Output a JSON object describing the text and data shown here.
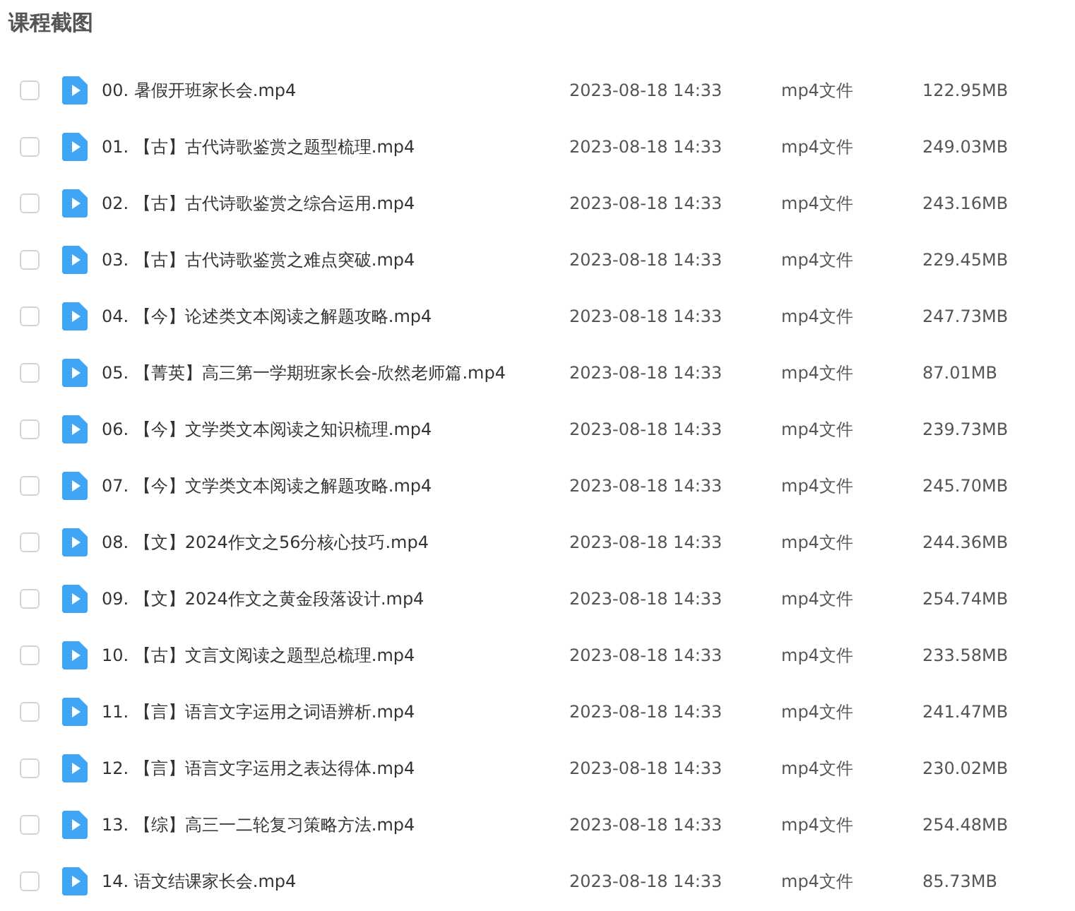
{
  "title": "课程截图",
  "files": [
    {
      "name": "00. 暑假开班家长会.mp4",
      "date": "2023-08-18 14:33",
      "type": "mp4文件",
      "size": "122.95MB",
      "checked": false
    },
    {
      "name": "01. 【古】古代诗歌鉴赏之题型梳理.mp4",
      "date": "2023-08-18 14:33",
      "type": "mp4文件",
      "size": "249.03MB",
      "checked": false
    },
    {
      "name": "02. 【古】古代诗歌鉴赏之综合运用.mp4",
      "date": "2023-08-18 14:33",
      "type": "mp4文件",
      "size": "243.16MB",
      "checked": false
    },
    {
      "name": "03. 【古】古代诗歌鉴赏之难点突破.mp4",
      "date": "2023-08-18 14:33",
      "type": "mp4文件",
      "size": "229.45MB",
      "checked": false
    },
    {
      "name": "04. 【今】论述类文本阅读之解题攻略.mp4",
      "date": "2023-08-18 14:33",
      "type": "mp4文件",
      "size": "247.73MB",
      "checked": false
    },
    {
      "name": "05. 【菁英】高三第一学期班家长会-欣然老师篇.mp4",
      "date": "2023-08-18 14:33",
      "type": "mp4文件",
      "size": "87.01MB",
      "checked": false
    },
    {
      "name": "06. 【今】文学类文本阅读之知识梳理.mp4",
      "date": "2023-08-18 14:33",
      "type": "mp4文件",
      "size": "239.73MB",
      "checked": false
    },
    {
      "name": "07. 【今】文学类文本阅读之解题攻略.mp4",
      "date": "2023-08-18 14:33",
      "type": "mp4文件",
      "size": "245.70MB",
      "checked": false
    },
    {
      "name": "08. 【文】2024作文之56分核心技巧.mp4",
      "date": "2023-08-18 14:33",
      "type": "mp4文件",
      "size": "244.36MB",
      "checked": false
    },
    {
      "name": "09. 【文】2024作文之黄金段落设计.mp4",
      "date": "2023-08-18 14:33",
      "type": "mp4文件",
      "size": "254.74MB",
      "checked": false
    },
    {
      "name": "10. 【古】文言文阅读之题型总梳理.mp4",
      "date": "2023-08-18 14:33",
      "type": "mp4文件",
      "size": "233.58MB",
      "checked": false
    },
    {
      "name": "11. 【言】语言文字运用之词语辨析.mp4",
      "date": "2023-08-18 14:33",
      "type": "mp4文件",
      "size": "241.47MB",
      "checked": false
    },
    {
      "name": "12. 【言】语言文字运用之表达得体.mp4",
      "date": "2023-08-18 14:33",
      "type": "mp4文件",
      "size": "230.02MB",
      "checked": false
    },
    {
      "name": "13. 【综】高三一二轮复习策略方法.mp4",
      "date": "2023-08-18 14:33",
      "type": "mp4文件",
      "size": "254.48MB",
      "checked": false
    },
    {
      "name": "14. 语文结课家长会.mp4",
      "date": "2023-08-18 14:33",
      "type": "mp4文件",
      "size": "85.73MB",
      "checked": false
    }
  ]
}
